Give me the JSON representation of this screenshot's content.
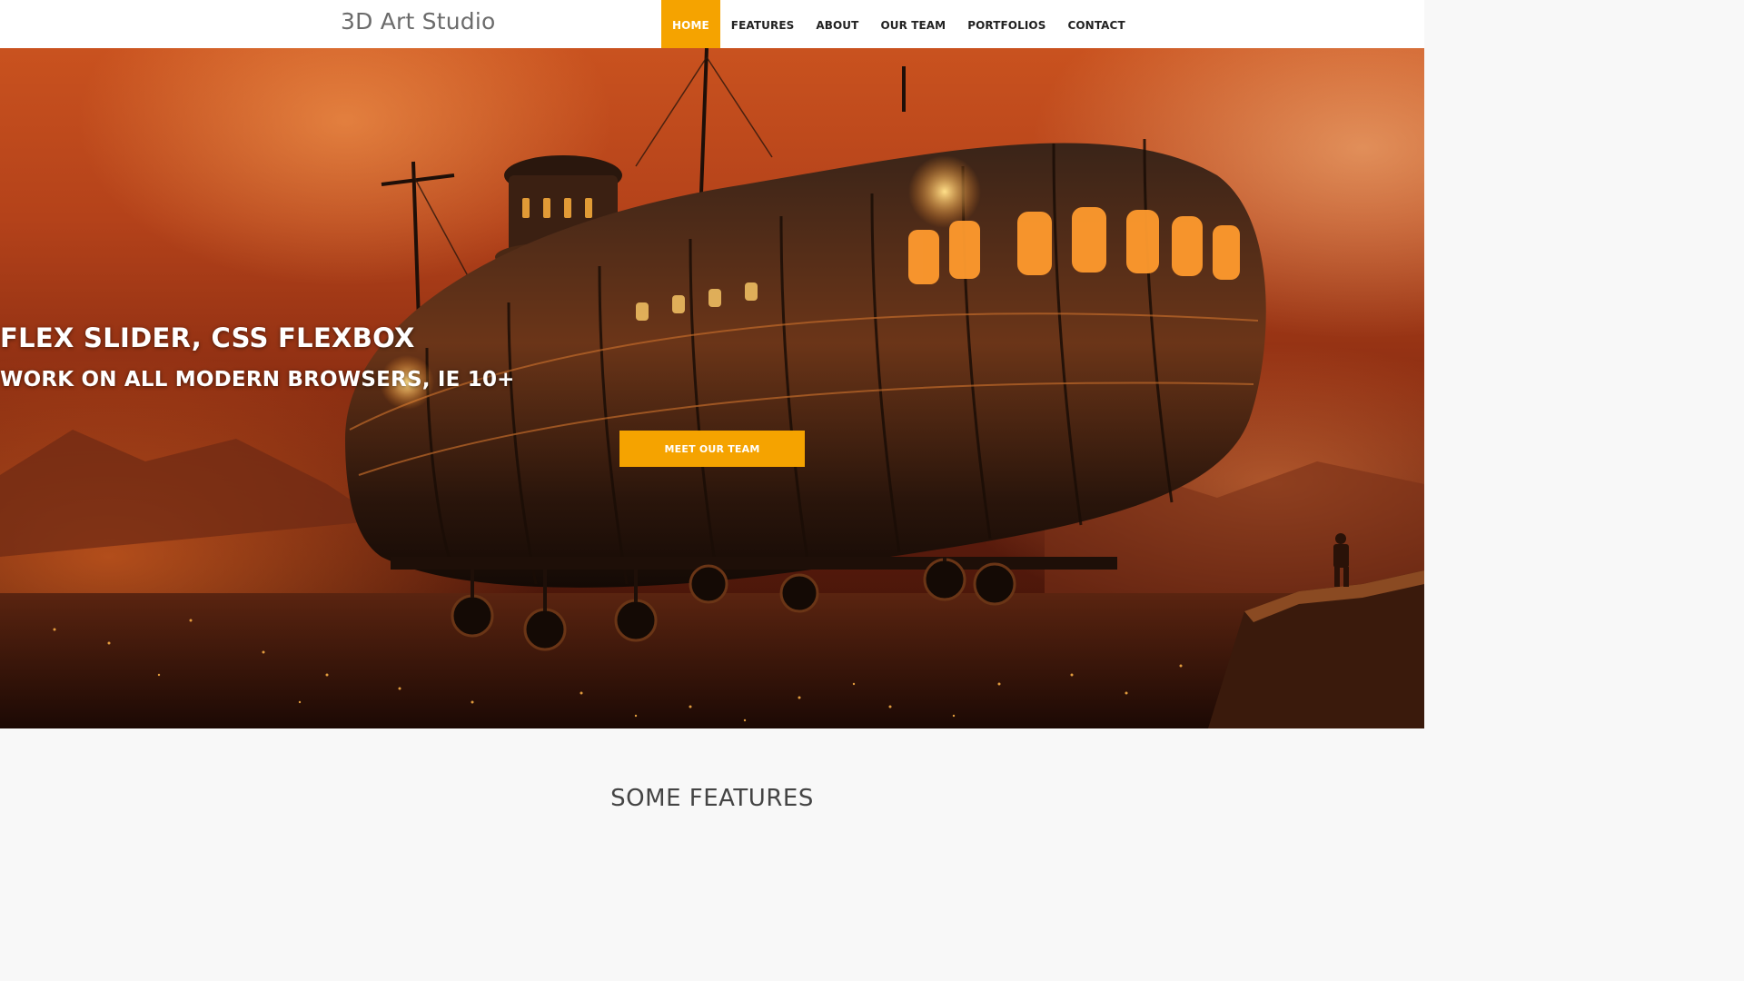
{
  "header": {
    "brand": "3D Art Studio",
    "nav": [
      {
        "label": "HOME",
        "active": true
      },
      {
        "label": "FEATURES",
        "active": false
      },
      {
        "label": "ABOUT",
        "active": false
      },
      {
        "label": "OUR TEAM",
        "active": false
      },
      {
        "label": "PORTFOLIOS",
        "active": false
      },
      {
        "label": "CONTACT",
        "active": false
      }
    ]
  },
  "hero": {
    "title": "FLEX SLIDER, CSS FLEXBOX",
    "subtitle": "WORK ON ALL MODERN BROWSERS, IE 10+",
    "button_label": "MEET OUR TEAM",
    "image_icon": "steampunk-airship-image"
  },
  "features": {
    "heading": "SOME FEATURES"
  },
  "colors": {
    "accent": "#f5a300",
    "header_bg": "#ffffff",
    "section_bg": "#f8f8f8",
    "brand_text": "#6b6b6b"
  }
}
